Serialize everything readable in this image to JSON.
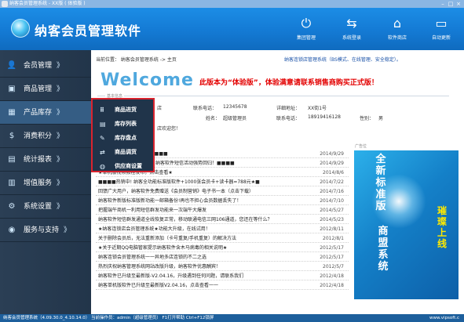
{
  "window": {
    "title": "纳客会员管理系统 - XX版 ( 体验版 )"
  },
  "header": {
    "app_title": "纳客会员管理软件",
    "buttons": [
      {
        "label": "集团管理",
        "icon": "power-icon"
      },
      {
        "label": "系统登录",
        "icon": "login-icon"
      },
      {
        "label": "软件商店",
        "icon": "store-icon"
      },
      {
        "label": "自动更新",
        "icon": "update-icon"
      }
    ]
  },
  "sidebar": {
    "items": [
      {
        "label": "会员管理",
        "icon": "user-icon"
      },
      {
        "label": "商品管理",
        "icon": "box-icon"
      },
      {
        "label": "产品库存",
        "icon": "stock-icon",
        "active": true
      },
      {
        "label": "消费积分",
        "icon": "coin-icon"
      },
      {
        "label": "统计报表",
        "icon": "chart-icon"
      },
      {
        "label": "增值服务",
        "icon": "value-icon"
      },
      {
        "label": "系统设置",
        "icon": "settings-icon"
      },
      {
        "label": "服务与支持",
        "icon": "support-icon"
      }
    ],
    "arrow": "》"
  },
  "popup": {
    "items": [
      {
        "label": "商品进货",
        "icon": "grid-icon"
      },
      {
        "label": "库存列表",
        "icon": "list-icon"
      },
      {
        "label": "库存盘点",
        "icon": "check-icon"
      },
      {
        "label": "商品调货",
        "icon": "transfer-icon"
      },
      {
        "label": "供应商设置",
        "icon": "supplier-icon"
      }
    ]
  },
  "main": {
    "breadcrumb": "当前位置： 纳客会员管理系统 -> 主页",
    "notice": "纳客连锁店管理系统（BS模式、在线管理、安全稳定）。",
    "welcome": "Welcome",
    "trial": "此版本为“体验版”，体验满意请联系销售商购买正式版！",
    "base_section": "基本信息",
    "base_info": {
      "line1": [
        "店",
        "联系电话：",
        "12345678",
        "详细地址：",
        "XX街1号"
      ],
      "line2": [
        "姓名：",
        "超级管理员",
        "联系电话：",
        "18919416128",
        "性别：",
        "男"
      ],
      "line3": "店欢迎您！"
    },
    "news": [
      {
        "title": "软件新用户短信使用须知■■■■",
        "date": "2014/9/29"
      },
      {
        "title": "，纳客软件短信活动强势回归！■■■■",
        "date": "2014/9/29"
      },
      {
        "title": "★单机版视频教程发布，点击查看★",
        "date": "2014/8/6"
      },
      {
        "title": "■■■■热销中! 纳客全功能标准版软件+1000张会员卡+读卡器=788元★■",
        "date": "2014/7/22"
      },
      {
        "title": "回馈广大用户，纳客软件免费赠送《会员制营销》电子书一本（点击下载）",
        "date": "2014/7/16"
      },
      {
        "title": "纳客软件新版标准版新功能一邮箱备份!再也不担心会员数据丢失了！",
        "date": "2014/7/10"
      },
      {
        "title": "把握端午商机一利用短信群发功能来一次端午大爆发",
        "date": "2014/5/27"
      },
      {
        "title": "纳客软件短信群发通道全线恢复正常，移动联通电信三网106通道，您还在等什么？",
        "date": "2014/5/23"
      },
      {
        "title": "★纳客连锁店会员管理系统★功能大升级，在线试用！",
        "date": "2012/8/11"
      },
      {
        "title": "关于删除会员后，无法重新添加（卡号重复/手机重复）的解决方法",
        "date": "2012/8/1"
      },
      {
        "title": "★关于近期QQ电脑管家提示纳客软件含木马病毒的相关说明★",
        "date": "2012/5/17"
      },
      {
        "title": "纳客连锁会员管理系统一一异地多店连锁的不二之选",
        "date": "2012/5/17"
      },
      {
        "title": "热烈庆祝纳客管理系统网站改版升级，纳客软件优惠酬宾！",
        "date": "2012/5/7"
      },
      {
        "title": "纳客软件已升级至最新版-V2.04.16，升级遇到任何问题，请联系我们",
        "date": "2012/4/18"
      },
      {
        "title": "纳客单机版软件已升级至最新版V2.04.16，点击查看一一",
        "date": "2012/4/18"
      }
    ],
    "ad_section": "广告位",
    "ad": {
      "left_text": "全新标准版",
      "mid_text": "商盟系统",
      "yellow_text": "璀璨上线"
    }
  },
  "statusbar": {
    "text": "纳客会员管理系统（4.09.30.0_4.10.14.0） 当前操作员：admin（超级管理员） F1打开帮助 Ctrl+F12锁屏",
    "url": "www.vipsoft.c"
  },
  "colors": {
    "header_blue": "#147ad4",
    "sidebar": "#2b3f55",
    "popup_border": "#d9232e",
    "welcome": "#4fa8de",
    "trial_red": "#e30000",
    "status_bar": "#1d5f9c"
  }
}
